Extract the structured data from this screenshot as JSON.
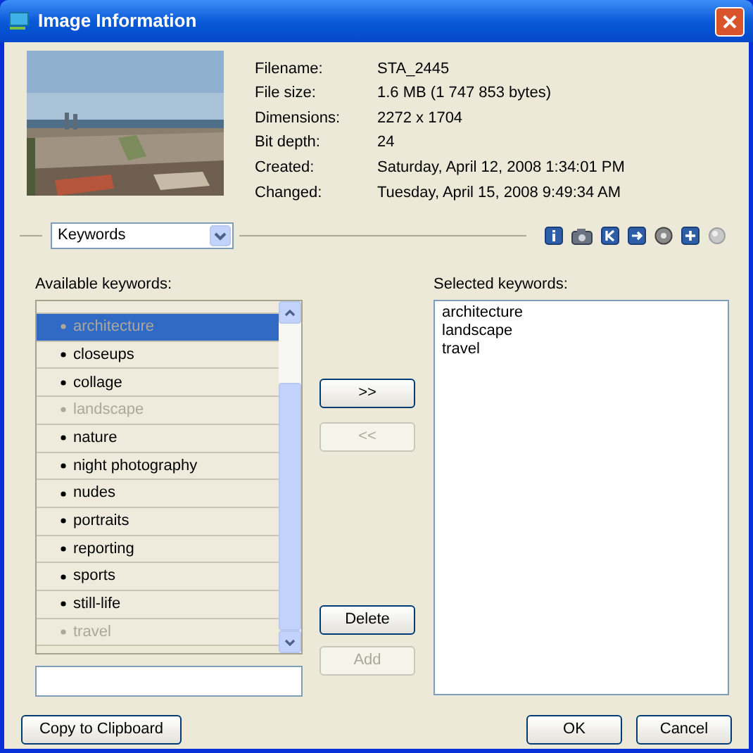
{
  "window": {
    "title": "Image Information"
  },
  "info": [
    {
      "label": "Filename:",
      "value": "STA_2445"
    },
    {
      "label": "File size:",
      "value": "1.6 MB (1 747 853 bytes)"
    },
    {
      "label": "Dimensions:",
      "value": "2272 x 1704"
    },
    {
      "label": "Bit depth:",
      "value": "24"
    },
    {
      "label": "Created:",
      "value": "Saturday, April 12, 2008 1:34:01 PM"
    },
    {
      "label": "Changed:",
      "value": "Tuesday, April 15, 2008 9:49:34 AM"
    }
  ],
  "section_select": {
    "value": "Keywords"
  },
  "available_label": "Available keywords:",
  "available_keywords": [
    {
      "name": "architecture",
      "selected": true,
      "used": true
    },
    {
      "name": "closeups",
      "selected": false,
      "used": false
    },
    {
      "name": "collage",
      "selected": false,
      "used": false
    },
    {
      "name": "landscape",
      "selected": false,
      "used": true
    },
    {
      "name": "nature",
      "selected": false,
      "used": false
    },
    {
      "name": "night photography",
      "selected": false,
      "used": false
    },
    {
      "name": "nudes",
      "selected": false,
      "used": false
    },
    {
      "name": "portraits",
      "selected": false,
      "used": false
    },
    {
      "name": "reporting",
      "selected": false,
      "used": false
    },
    {
      "name": "sports",
      "selected": false,
      "used": false
    },
    {
      "name": "still-life",
      "selected": false,
      "used": false
    },
    {
      "name": "travel",
      "selected": false,
      "used": true
    }
  ],
  "move_buttons": [
    {
      "label": ">>",
      "disabled": false
    },
    {
      "label": "<<",
      "disabled": true
    }
  ],
  "delete_button": {
    "label": "Delete",
    "disabled": false
  },
  "add_button": {
    "label": "Add",
    "disabled": true
  },
  "selected_label": "Selected keywords:",
  "selected_keywords": [
    "architecture",
    "landscape",
    "travel"
  ],
  "copy_button": "Copy to Clipboard",
  "ok_button": "OK",
  "cancel_button": "Cancel"
}
